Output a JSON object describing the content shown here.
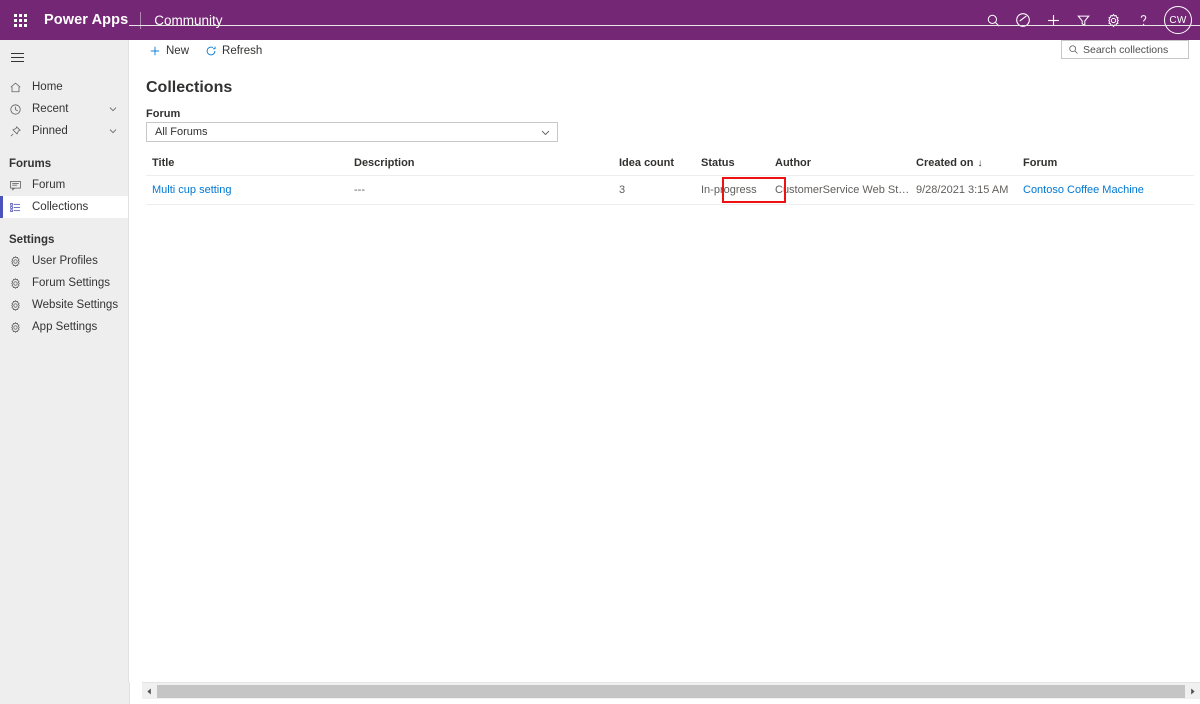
{
  "topbar": {
    "waffle_icon": "waffle-grid-icon",
    "brand": "Power Apps",
    "app_name": "Community",
    "icons": [
      {
        "name": "search-icon",
        "label": "Search"
      },
      {
        "name": "checkmark-circle-icon",
        "label": "Check"
      },
      {
        "name": "plus-icon",
        "label": "New"
      },
      {
        "name": "filter-icon",
        "label": "Filter"
      },
      {
        "name": "gear-icon",
        "label": "Settings"
      },
      {
        "name": "question-mark-icon",
        "label": "Help"
      }
    ],
    "avatar_initials": "CW"
  },
  "sidebar": {
    "hamburger_icon": "hamburger-menu-icon",
    "items": [
      {
        "label": "Home",
        "icon": "home-icon",
        "chevron": false,
        "selected": false
      },
      {
        "label": "Recent",
        "icon": "clock-icon",
        "chevron": true,
        "selected": false
      },
      {
        "label": "Pinned",
        "icon": "pin-icon",
        "chevron": true,
        "selected": false
      }
    ],
    "group_forums": "Forums",
    "forum_items": [
      {
        "label": "Forum",
        "icon": "message-icon",
        "selected": false
      },
      {
        "label": "Collections",
        "icon": "list-icon",
        "selected": true
      }
    ],
    "group_settings": "Settings",
    "settings_items": [
      {
        "label": "User Profiles",
        "icon": "gear-icon"
      },
      {
        "label": "Forum Settings",
        "icon": "gear-icon"
      },
      {
        "label": "Website Settings",
        "icon": "gear-icon"
      },
      {
        "label": "App Settings",
        "icon": "gear-icon"
      }
    ]
  },
  "commandbar": {
    "new_label": "New",
    "new_icon": "plus-icon",
    "refresh_label": "Refresh",
    "refresh_icon": "refresh-icon"
  },
  "search": {
    "placeholder": "Search collections",
    "value": "",
    "icon": "search-icon"
  },
  "page": {
    "title": "Collections",
    "filter_label": "Forum",
    "filter_value": "All Forums",
    "filter_chevron_icon": "chevron-down-icon"
  },
  "table": {
    "columns": [
      {
        "key": "title",
        "label": "Title"
      },
      {
        "key": "description",
        "label": "Description"
      },
      {
        "key": "idea_count",
        "label": "Idea count"
      },
      {
        "key": "status",
        "label": "Status"
      },
      {
        "key": "author",
        "label": "Author"
      },
      {
        "key": "created_on",
        "label": "Created on"
      },
      {
        "key": "forum",
        "label": "Forum"
      }
    ],
    "sorted_column": "created_on",
    "sort_arrow": "↓",
    "rows": [
      {
        "title": "Multi cup setting",
        "description": "---",
        "idea_count": "3",
        "status": "In-progress",
        "author": "CustomerService Web Staging",
        "created_on": "9/28/2021 3:15 AM",
        "forum": "Contoso Coffee Machine"
      }
    ]
  },
  "annotation": {
    "target": "status-cell",
    "color": "#ee1111"
  },
  "scrollbar": {
    "left_arrow_icon": "caret-left-icon",
    "right_arrow_icon": "caret-right-icon"
  },
  "colors": {
    "brand_purple": "#742774",
    "link_blue": "#0078d4",
    "sidebar_bg": "#efeeee",
    "selected_accent": "#4b53bc",
    "annotation_red": "#ee1111"
  }
}
